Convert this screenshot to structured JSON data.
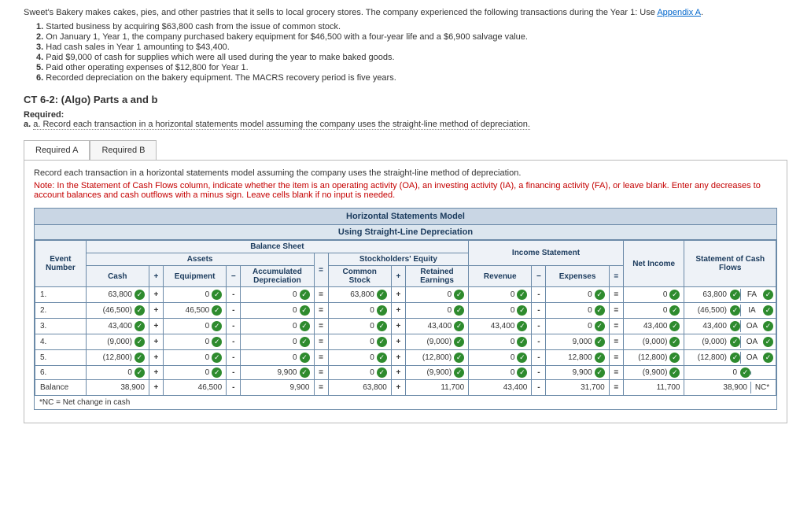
{
  "intro": {
    "line1": "Sweet's Bakery makes cakes, pies, and other pastries that it sells to local grocery stores. The company experienced the following transactions during the Year 1: Use ",
    "link": "Appendix A",
    "list": [
      {
        "n": "1.",
        "t": "Started business by acquiring $63,800 cash from the issue of common stock."
      },
      {
        "n": "2.",
        "t": "On January 1, Year 1, the company purchased bakery equipment for $46,500 with a four-year life and a $6,900 salvage value."
      },
      {
        "n": "3.",
        "t": "Had cash sales in Year 1 amounting to $43,400."
      },
      {
        "n": "4.",
        "t": "Paid $9,000 of cash for supplies which were all used during the year to make baked goods."
      },
      {
        "n": "5.",
        "t": "Paid other operating expenses of $12,800 for Year 1."
      },
      {
        "n": "6.",
        "t": "Recorded depreciation on the bakery equipment. The MACRS recovery period is five years."
      }
    ]
  },
  "ct_title": "CT 6-2: (Algo) Parts a and b",
  "required_label": "Required:",
  "required_a": "a. Record each transaction in a horizontal statements model assuming the company uses the straight-line method of depreciation.",
  "tabs": {
    "a": "Required A",
    "b": "Required B"
  },
  "panel": {
    "instr": "Record each transaction in a horizontal statements model assuming the company uses the straight-line method of depreciation.",
    "note": "Note: In the Statement of Cash Flows column, indicate whether the item is an operating activity (OA), an investing activity (IA), a financing activity (FA), or leave blank. Enter any decreases to account balances and cash outflows with a minus sign. Leave cells blank if no input is needed."
  },
  "model": {
    "title": "Horizontal Statements Model",
    "subtitle": "Using Straight-Line Depreciation",
    "groups": {
      "balance_sheet": "Balance Sheet",
      "income_statement": "Income Statement",
      "assets": "Assets",
      "stockholders_equity": "Stockholders' Equity"
    },
    "headers": {
      "event": "Event Number",
      "cash": "Cash",
      "equipment": "Equipment",
      "accdep": "Accumulated Depreciation",
      "cstock": "Common Stock",
      "re": "Retained Earnings",
      "revenue": "Revenue",
      "expenses": "Expenses",
      "ni": "Net Income",
      "cf": "Statement of Cash Flows"
    },
    "rows": [
      {
        "ev": "1.",
        "cash": "63,800",
        "equip": "0",
        "accdep": "0",
        "cstock": "63,800",
        "re": "0",
        "rev": "0",
        "exp": "0",
        "ni": "0",
        "cf": "63,800",
        "tag": "FA"
      },
      {
        "ev": "2.",
        "cash": "(46,500)",
        "equip": "46,500",
        "accdep": "0",
        "cstock": "0",
        "re": "0",
        "rev": "0",
        "exp": "0",
        "ni": "0",
        "cf": "(46,500)",
        "tag": "IA"
      },
      {
        "ev": "3.",
        "cash": "43,400",
        "equip": "0",
        "accdep": "0",
        "cstock": "0",
        "re": "43,400",
        "rev": "43,400",
        "exp": "0",
        "ni": "43,400",
        "cf": "43,400",
        "tag": "OA"
      },
      {
        "ev": "4.",
        "cash": "(9,000)",
        "equip": "0",
        "accdep": "0",
        "cstock": "0",
        "re": "(9,000)",
        "rev": "0",
        "exp": "9,000",
        "ni": "(9,000)",
        "cf": "(9,000)",
        "tag": "OA"
      },
      {
        "ev": "5.",
        "cash": "(12,800)",
        "equip": "0",
        "accdep": "0",
        "cstock": "0",
        "re": "(12,800)",
        "rev": "0",
        "exp": "12,800",
        "ni": "(12,800)",
        "cf": "(12,800)",
        "tag": "OA"
      },
      {
        "ev": "6.",
        "cash": "0",
        "equip": "0",
        "accdep": "9,900",
        "cstock": "0",
        "re": "(9,900)",
        "rev": "0",
        "exp": "9,900",
        "ni": "(9,900)",
        "cf": "0",
        "tag": ""
      }
    ],
    "balance": {
      "ev": "Balance",
      "cash": "38,900",
      "equip": "46,500",
      "accdep": "9,900",
      "cstock": "63,800",
      "re": "11,700",
      "rev": "43,400",
      "exp": "31,700",
      "ni": "11,700",
      "cf": "38,900",
      "tag": "NC*"
    },
    "footnote": "*NC = Net change in cash"
  },
  "ops": {
    "plus": "+",
    "minus": "−",
    "minus_asc": "-",
    "eq": "="
  }
}
